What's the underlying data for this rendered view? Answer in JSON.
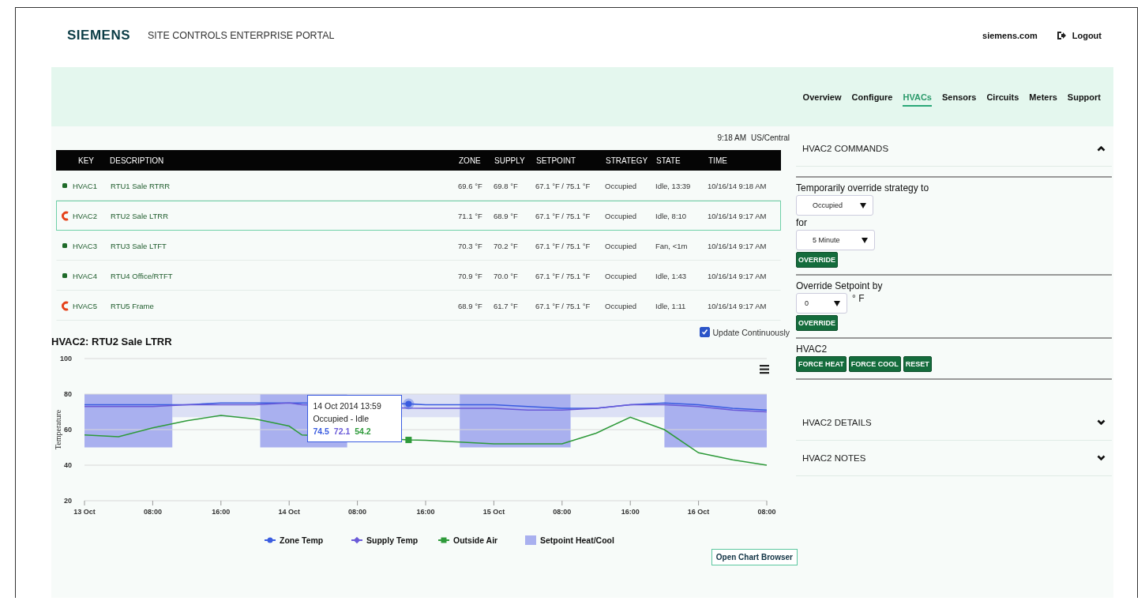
{
  "header": {
    "logo": "SIEMENS",
    "title": "SITE CONTROLS ENTERPRISE PORTAL",
    "site_link": "siemens.com",
    "logout": "Logout"
  },
  "nav": [
    {
      "label": "Overview",
      "selected": false
    },
    {
      "label": "Configure",
      "selected": false
    },
    {
      "label": "HVACs",
      "selected": true
    },
    {
      "label": "Sensors",
      "selected": false
    },
    {
      "label": "Circuits",
      "selected": false
    },
    {
      "label": "Meters",
      "selected": false
    },
    {
      "label": "Support",
      "selected": false
    }
  ],
  "clock": {
    "time": "9:18 AM",
    "zone": "US/Central"
  },
  "table": {
    "columns": [
      "KEY",
      "DESCRIPTION",
      "ZONE",
      "SUPPLY",
      "SETPOINT",
      "STRATEGY",
      "STATE",
      "TIME"
    ],
    "rows": [
      {
        "kind": "dot",
        "key": "HVAC1",
        "description": "RTU1 Sale RTRR",
        "zone": "69.6 °F",
        "supply": "69.8 °F",
        "setpoint": "67.1 °F / 75.1 °F",
        "strategy": "Occupied",
        "state": "Idle, 13:39",
        "time": "10/16/14 9:18 AM",
        "selected": false
      },
      {
        "kind": "c",
        "key": "HVAC2",
        "description": "RTU2 Sale LTRR",
        "zone": "71.1 °F",
        "supply": "68.9 °F",
        "setpoint": "67.1 °F / 75.1 °F",
        "strategy": "Occupied",
        "state": "Idle, 8:10",
        "time": "10/16/14 9:17 AM",
        "selected": true
      },
      {
        "kind": "dot",
        "key": "HVAC3",
        "description": "RTU3 Sale LTFT",
        "zone": "70.3 °F",
        "supply": "70.2 °F",
        "setpoint": "67.1 °F / 75.1 °F",
        "strategy": "Occupied",
        "state": "Fan, <1m",
        "time": "10/16/14 9:17 AM",
        "selected": false
      },
      {
        "kind": "dot",
        "key": "HVAC4",
        "description": "RTU4 Office/RTFT",
        "zone": "70.9 °F",
        "supply": "70.0 °F",
        "setpoint": "67.1 °F / 75.1 °F",
        "strategy": "Occupied",
        "state": "Idle, 1:43",
        "time": "10/16/14 9:17 AM",
        "selected": false
      },
      {
        "kind": "c",
        "key": "HVAC5",
        "description": "RTU5 Frame",
        "zone": "68.9 °F",
        "supply": "61.7 °F",
        "setpoint": "67.1 °F / 75.1 °F",
        "strategy": "Occupied",
        "state": "Idle, 1:11",
        "time": "10/16/14 9:17 AM",
        "selected": false
      }
    ]
  },
  "update": {
    "label": "Update Continuously",
    "checked": true
  },
  "chart": {
    "title": "HVAC2: RTU2 Sale LTRR",
    "chart_data": {
      "type": "line",
      "ylabel": "Temperature",
      "x": [
        "2014-10-13 00:00",
        "2014-10-13 04:00",
        "2014-10-13 08:00",
        "2014-10-13 12:00",
        "2014-10-13 16:00",
        "2014-10-13 20:00",
        "2014-10-14 00:00",
        "2014-10-14 01:30",
        "2014-10-14 14:00",
        "2014-10-14 16:00",
        "2014-10-14 20:00",
        "2014-10-15 00:00",
        "2014-10-15 04:00",
        "2014-10-15 08:00",
        "2014-10-15 12:00",
        "2014-10-15 16:00",
        "2014-10-15 20:00",
        "2014-10-16 00:00",
        "2014-10-16 04:00",
        "2014-10-16 08:00"
      ],
      "series": [
        {
          "name": "Zone Temp",
          "color": "#3a5ce0",
          "values": [
            74,
            74,
            74,
            74,
            75,
            75,
            75,
            75,
            74.5,
            74,
            74,
            74,
            73,
            72,
            72,
            74,
            75,
            74,
            72,
            71
          ]
        },
        {
          "name": "Supply Temp",
          "color": "#6a5ad8",
          "values": [
            73,
            73,
            73,
            74,
            74,
            74,
            75,
            74,
            72.1,
            72,
            72,
            72,
            71,
            71,
            72,
            74,
            74,
            73,
            71,
            70
          ]
        },
        {
          "name": "Outside Air",
          "color": "#2e9a3a",
          "values": [
            57,
            56,
            61,
            65,
            68,
            66,
            62,
            57,
            54.2,
            54,
            53,
            52,
            52,
            52,
            58,
            67,
            60,
            47,
            43,
            40
          ]
        }
      ],
      "xlim": [
        "2014-10-13 00:00",
        "2014-10-16 08:00"
      ],
      "ylim": [
        20,
        100
      ],
      "yticks": [
        20,
        40,
        60,
        80,
        100
      ],
      "legend": "bottom",
      "xticks": [
        {
          "value": "2014-10-13 00:00",
          "label": "13 Oct"
        },
        {
          "value": "2014-10-13 08:00",
          "label": "08:00"
        },
        {
          "value": "2014-10-13 16:00",
          "label": "16:00"
        },
        {
          "value": "2014-10-14 00:00",
          "label": "14 Oct"
        },
        {
          "value": "2014-10-14 08:00",
          "label": "08:00"
        },
        {
          "value": "2014-10-14 16:00",
          "label": "16:00"
        },
        {
          "value": "2014-10-15 00:00",
          "label": "15 Oct"
        },
        {
          "value": "2014-10-15 08:00",
          "label": "08:00"
        },
        {
          "value": "2014-10-15 16:00",
          "label": "16:00"
        },
        {
          "value": "2014-10-16 00:00",
          "label": "16 Oct"
        },
        {
          "value": "2014-10-16 08:00",
          "label": "08:00"
        }
      ],
      "grid": true
    },
    "band_legend": {
      "name": "Setpoint Heat/Cool",
      "color": "#a9b0ef"
    },
    "tooltip": {
      "title": "14 Oct 2014 13:59",
      "status": "Occupied - Idle",
      "values": [
        "74.5",
        "72.1",
        "54.2"
      ]
    },
    "browser_button": "Open Chart Browser"
  },
  "commands": {
    "title": "HVAC2 COMMANDS",
    "expanded": true,
    "strategy_label": "Temporarily override strategy to",
    "strategy": "Occupied",
    "for_label": "for",
    "duration": "5 Minute",
    "strategy_button": "OVERRIDE",
    "setpoint_label": "Override Setpoint by",
    "setpoint": "0",
    "unit": "° F",
    "setpoint_button": "OVERRIDE",
    "force_label": "HVAC2",
    "force_buttons": [
      "FORCE HEAT",
      "FORCE COOL",
      "RESET"
    ]
  },
  "sections": [
    {
      "title": "HVAC2 DETAILS",
      "expanded": false
    },
    {
      "title": "HVAC2 NOTES",
      "expanded": false
    }
  ]
}
